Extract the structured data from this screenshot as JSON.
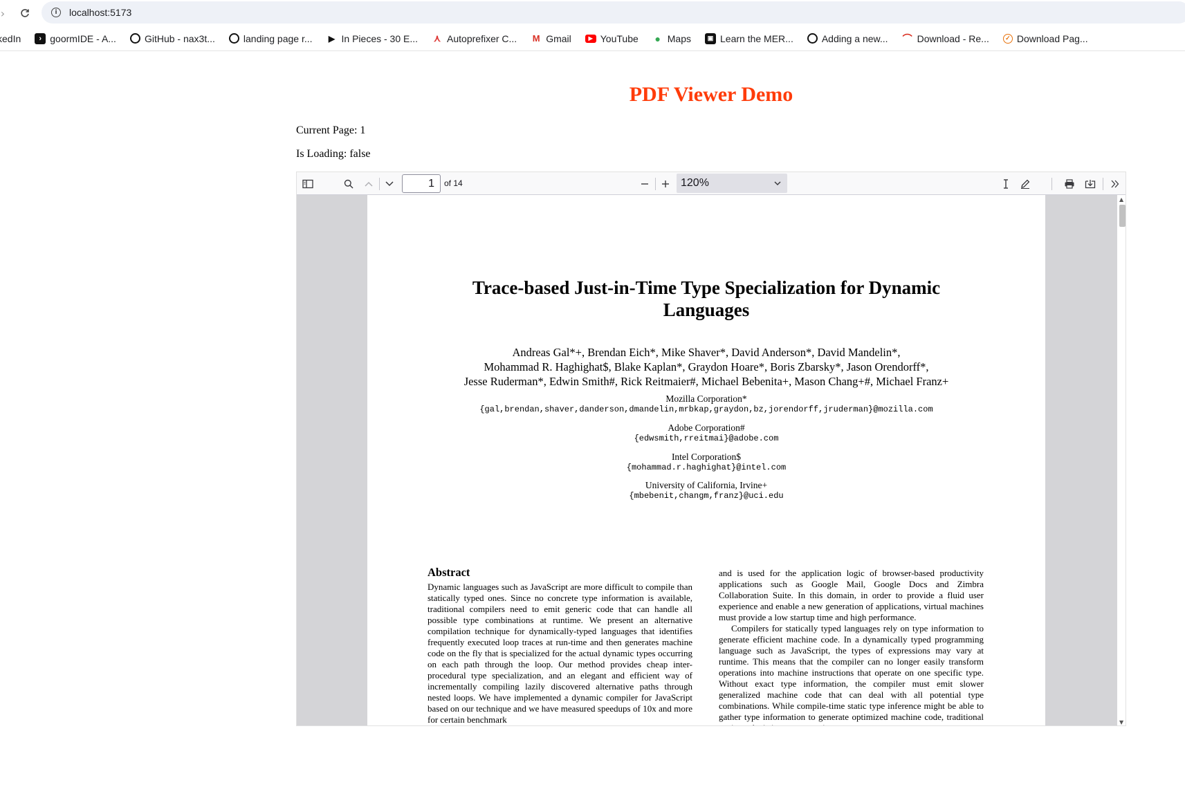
{
  "browser": {
    "url": "localhost:5173",
    "bookmarks": [
      {
        "label": "kedIn",
        "icon": "linkedin-icon"
      },
      {
        "label": "goormIDE - A...",
        "icon": "goorm-icon"
      },
      {
        "label": "GitHub - nax3t...",
        "icon": "github-icon"
      },
      {
        "label": "landing page r...",
        "icon": "github-icon"
      },
      {
        "label": "In Pieces - 30 E...",
        "icon": "play-icon"
      },
      {
        "label": "Autoprefixer C...",
        "icon": "autoprefixer-icon"
      },
      {
        "label": "Gmail",
        "icon": "gmail-icon"
      },
      {
        "label": "YouTube",
        "icon": "youtube-icon"
      },
      {
        "label": "Maps",
        "icon": "maps-icon"
      },
      {
        "label": "Learn the MER...",
        "icon": "learn-icon"
      },
      {
        "label": "Adding a new...",
        "icon": "github-icon"
      },
      {
        "label": "Download - Re...",
        "icon": "redis-icon"
      },
      {
        "label": "Download Pag...",
        "icon": "download-icon"
      }
    ]
  },
  "page": {
    "title": "PDF Viewer Demo",
    "current_page_label": "Current Page: 1",
    "loading_label": "Is Loading: false"
  },
  "viewer": {
    "page_number": "1",
    "page_count_label": "of 14",
    "zoom": "120%"
  },
  "document": {
    "title_line1": "Trace-based Just-in-Time Type Specialization for Dynamic",
    "title_line2": "Languages",
    "authors_line1": "Andreas Gal*+, Brendan Eich*, Mike Shaver*, David Anderson*, David Mandelin*,",
    "authors_line2": "Mohammad R. Haghighat$, Blake Kaplan*, Graydon Hoare*, Boris Zbarsky*, Jason Orendorff*,",
    "authors_line3": "Jesse Ruderman*, Edwin Smith#, Rick Reitmaier#, Michael Bebenita+, Mason Chang+#, Michael Franz+",
    "affiliations": [
      {
        "name": "Mozilla Corporation*",
        "email": "{gal,brendan,shaver,danderson,dmandelin,mrbkap,graydon,bz,jorendorff,jruderman}@mozilla.com"
      },
      {
        "name": "Adobe Corporation#",
        "email": "{edwsmith,rreitmai}@adobe.com"
      },
      {
        "name": "Intel Corporation$",
        "email": "{mohammad.r.haghighat}@intel.com"
      },
      {
        "name": "University of California, Irvine+",
        "email": "{mbebenit,changm,franz}@uci.edu"
      }
    ],
    "abstract_heading": "Abstract",
    "abstract_text": "Dynamic languages such as JavaScript are more difficult to compile than statically typed ones. Since no concrete type information is available, traditional compilers need to emit generic code that can handle all possible type combinations at runtime. We present an alternative compilation technique for dynamically-typed languages that identifies frequently executed loop traces at run-time and then generates machine code on the fly that is specialized for the actual dynamic types occurring on each path through the loop. Our method provides cheap inter-procedural type specialization, and an elegant and efficient way of incrementally compiling lazily discovered alternative paths through nested loops. We have implemented a dynamic compiler for JavaScript based on our technique and we have measured speedups of 10x and more for certain benchmark",
    "right_col_p1": "and is used for the application logic of browser-based productivity applications such as Google Mail, Google Docs and Zimbra Collaboration Suite. In this domain, in order to provide a fluid user experience and enable a new generation of applications, virtual machines must provide a low startup time and high performance.",
    "right_col_p2": "Compilers for statically typed languages rely on type information to generate efficient machine code. In a dynamically typed programming language such as JavaScript, the types of expressions may vary at runtime. This means that the compiler can no longer easily transform operations into machine instructions that operate on one specific type. Without exact type information, the compiler must emit slower generalized machine code that can deal with all potential type combinations. While compile-time static type inference might be able to gather type information to generate optimized machine code, traditional static analysis is very expensive"
  }
}
